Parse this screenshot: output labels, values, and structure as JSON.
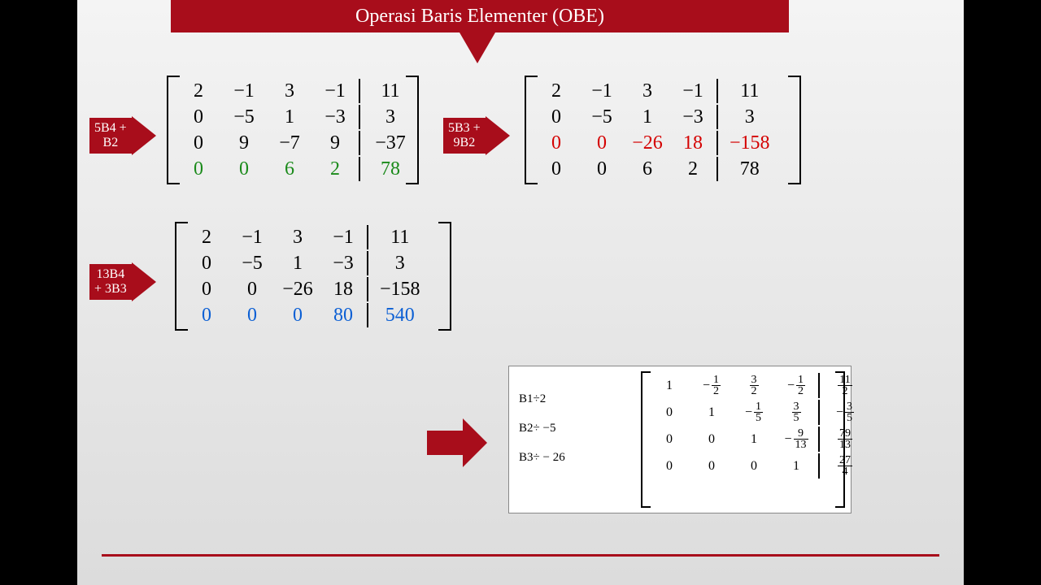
{
  "title": "Operasi Baris Elementer (OBE)",
  "ops": {
    "a": [
      "5B4 +",
      "B2"
    ],
    "b": [
      "5B3 +",
      "9B2"
    ],
    "c": [
      "13B4",
      "+ 3B3"
    ],
    "d": [
      "B1÷2",
      "B2÷ −5",
      "B3÷ − 26"
    ]
  },
  "matrices": {
    "m1": {
      "rows": [
        {
          "cells": [
            "2",
            "−1",
            "3",
            "−1",
            "11"
          ]
        },
        {
          "cells": [
            "0",
            "−5",
            "1",
            "−3",
            "3"
          ]
        },
        {
          "cells": [
            "0",
            "9",
            "−7",
            "9",
            "−37"
          ]
        },
        {
          "cells": [
            "0",
            "0",
            "6",
            "2",
            "78"
          ],
          "class": "green"
        }
      ]
    },
    "m2": {
      "rows": [
        {
          "cells": [
            "2",
            "−1",
            "3",
            "−1",
            "11"
          ]
        },
        {
          "cells": [
            "0",
            "−5",
            "1",
            "−3",
            "3"
          ]
        },
        {
          "cells": [
            "0",
            "0",
            "−26",
            "18",
            "−158"
          ],
          "class": "red"
        },
        {
          "cells": [
            "0",
            "0",
            "6",
            "2",
            "78"
          ]
        }
      ]
    },
    "m3": {
      "rows": [
        {
          "cells": [
            "2",
            "−1",
            "3",
            "−1",
            "11"
          ]
        },
        {
          "cells": [
            "0",
            "−5",
            "1",
            "−3",
            "3"
          ]
        },
        {
          "cells": [
            "0",
            "0",
            "−26",
            "18",
            "−158"
          ]
        },
        {
          "cells": [
            "0",
            "0",
            "0",
            "80",
            "540"
          ],
          "class": "blue"
        }
      ]
    },
    "m4": {
      "rows": [
        [
          "1",
          {
            "neg": 1,
            "n": "1",
            "d": "2"
          },
          {
            "n": "3",
            "d": "2"
          },
          {
            "neg": 1,
            "n": "1",
            "d": "2"
          },
          {
            "n": "11",
            "d": "2"
          }
        ],
        [
          "0",
          "1",
          {
            "neg": 1,
            "n": "1",
            "d": "5"
          },
          {
            "n": "3",
            "d": "5"
          },
          {
            "neg": 1,
            "n": "3",
            "d": "5"
          }
        ],
        [
          "0",
          "0",
          "1",
          {
            "neg": 1,
            "n": "9",
            "d": "13"
          },
          {
            "n": "79",
            "d": "13"
          }
        ],
        [
          "0",
          "0",
          "0",
          "1",
          {
            "n": "27",
            "d": "4"
          }
        ]
      ]
    }
  }
}
